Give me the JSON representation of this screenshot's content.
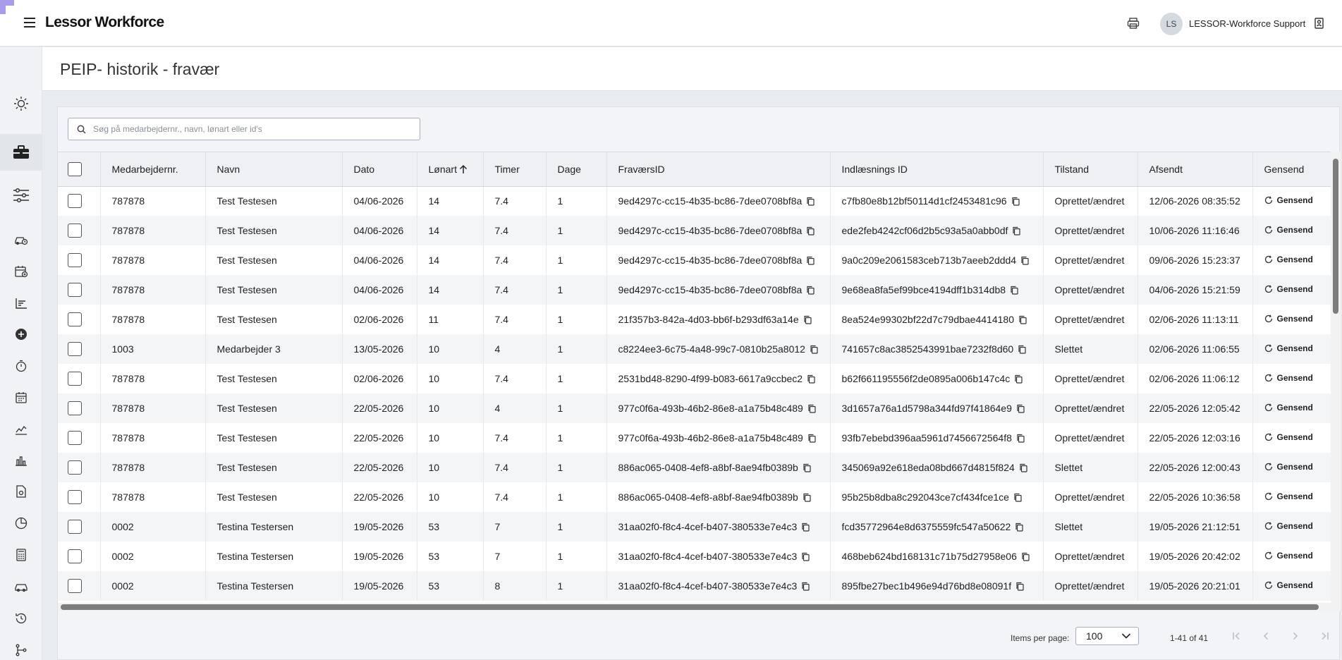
{
  "app": {
    "logo_text": "Lessor Workforce"
  },
  "header": {
    "avatar_initials": "LS",
    "user_name": "LESSOR-Workforce Support"
  },
  "page": {
    "title": "PEIP- historik - fravær"
  },
  "search": {
    "placeholder": "Søg på medarbejdernr., navn, lønart eller id's"
  },
  "table": {
    "columns": {
      "emp_no": "Medarbejdernr.",
      "name": "Navn",
      "date": "Dato",
      "wage_type": "Lønart",
      "hours": "Timer",
      "days": "Dage",
      "absence_id": "FraværsID",
      "import_id": "Indlæsnings ID",
      "state": "Tilstand",
      "sent": "Afsendt",
      "resend": "Gensend"
    },
    "sort": {
      "column": "Lønart",
      "direction": "ascending"
    },
    "resend_label": "Gensend",
    "rows": [
      [
        "787878",
        "Test Testesen",
        "04/06-2026",
        "14",
        "7.4",
        "1",
        "9ed4297c-cc15-4b35-bc86-7dee0708bf8a",
        "c7fb80e8b12bf50114d1cf2453481c96",
        "Oprettet/ændret",
        "12/06-2026 08:35:52"
      ],
      [
        "787878",
        "Test Testesen",
        "04/06-2026",
        "14",
        "7.4",
        "1",
        "9ed4297c-cc15-4b35-bc86-7dee0708bf8a",
        "ede2feb4242cf06d2b5c93a5a0abb0df",
        "Oprettet/ændret",
        "10/06-2026 11:16:46"
      ],
      [
        "787878",
        "Test Testesen",
        "04/06-2026",
        "14",
        "7.4",
        "1",
        "9ed4297c-cc15-4b35-bc86-7dee0708bf8a",
        "9a0c209e2061583ceb713b7aeeb2ddd4",
        "Oprettet/ændret",
        "09/06-2026 15:23:37"
      ],
      [
        "787878",
        "Test Testesen",
        "04/06-2026",
        "14",
        "7.4",
        "1",
        "9ed4297c-cc15-4b35-bc86-7dee0708bf8a",
        "9e68ea8fa5ef99bce4194dff1b314db8",
        "Oprettet/ændret",
        "04/06-2026 15:21:59"
      ],
      [
        "787878",
        "Test Testesen",
        "02/06-2026",
        "11",
        "7.4",
        "1",
        "21f357b3-842a-4d03-bb6f-b293df63a14e",
        "8ea524e99302bf22d7c79dbae4414180",
        "Oprettet/ændret",
        "02/06-2026 11:13:11"
      ],
      [
        "1003",
        "Medarbejder 3",
        "13/05-2026",
        "10",
        "4",
        "1",
        "c8224ee3-6c75-4a48-99c7-0810b25a8012",
        "741657c8ac3852543991bae7232f8d60",
        "Slettet",
        "02/06-2026 11:06:55"
      ],
      [
        "787878",
        "Test Testesen",
        "02/06-2026",
        "10",
        "7.4",
        "1",
        "2531bd48-8290-4f99-b083-6617a9ccbec2",
        "b62f661195556f2de0895a006b147c4c",
        "Oprettet/ændret",
        "02/06-2026 11:06:12"
      ],
      [
        "787878",
        "Test Testesen",
        "22/05-2026",
        "10",
        "4",
        "1",
        "977c0f6a-493b-46b2-86e8-a1a75b48c489",
        "3d1657a76a1d5798a344fd97f41864e9",
        "Oprettet/ændret",
        "22/05-2026 12:05:42"
      ],
      [
        "787878",
        "Test Testesen",
        "22/05-2026",
        "10",
        "7.4",
        "1",
        "977c0f6a-493b-46b2-86e8-a1a75b48c489",
        "93fb7ebebd396aa5961d7456672564f8",
        "Oprettet/ændret",
        "22/05-2026 12:03:16"
      ],
      [
        "787878",
        "Test Testesen",
        "22/05-2026",
        "10",
        "7.4",
        "1",
        "886ac065-0408-4ef8-a8bf-8ae94fb0389b",
        "345069a92e618eda08bd667d4815f824",
        "Slettet",
        "22/05-2026 12:00:43"
      ],
      [
        "787878",
        "Test Testesen",
        "22/05-2026",
        "10",
        "7.4",
        "1",
        "886ac065-0408-4ef8-a8bf-8ae94fb0389b",
        "95b25b8dba8c292043ce7cf434fce1ce",
        "Oprettet/ændret",
        "22/05-2026 10:36:58"
      ],
      [
        "0002",
        "Testina Testersen",
        "19/05-2026",
        "53",
        "7",
        "1",
        "31aa02f0-f8c4-4cef-b407-380533e7e4c3",
        "fcd35772964e8d6375559fc547a50622",
        "Slettet",
        "19/05-2026 21:12:51"
      ],
      [
        "0002",
        "Testina Testersen",
        "19/05-2026",
        "53",
        "7",
        "1",
        "31aa02f0-f8c4-4cef-b407-380533e7e4c3",
        "468beb624bd168131c71b75d27958e06",
        "Oprettet/ændret",
        "19/05-2026 20:42:02"
      ],
      [
        "0002",
        "Testina Testersen",
        "19/05-2026",
        "53",
        "8",
        "1",
        "31aa02f0-f8c4-4cef-b407-380533e7e4c3",
        "895fbe27bec1b496e94d76bd8e08091f",
        "Oprettet/ændret",
        "19/05-2026 20:21:01"
      ]
    ]
  },
  "paginator": {
    "items_per_page_label": "Items per page:",
    "items_per_page_value": "100",
    "range_label": "1-41 of 41"
  },
  "icons": {
    "menu": "hamburger-icon",
    "print": "printer-icon",
    "logout": "logout-icon",
    "search": "search-icon",
    "copy": "copy-icon",
    "resend": "refresh-icon"
  },
  "colors": {
    "brand_mark": "#a89be8",
    "sidebar_bg": "#f0f2f5",
    "row_alt": "#f4f5f7"
  }
}
